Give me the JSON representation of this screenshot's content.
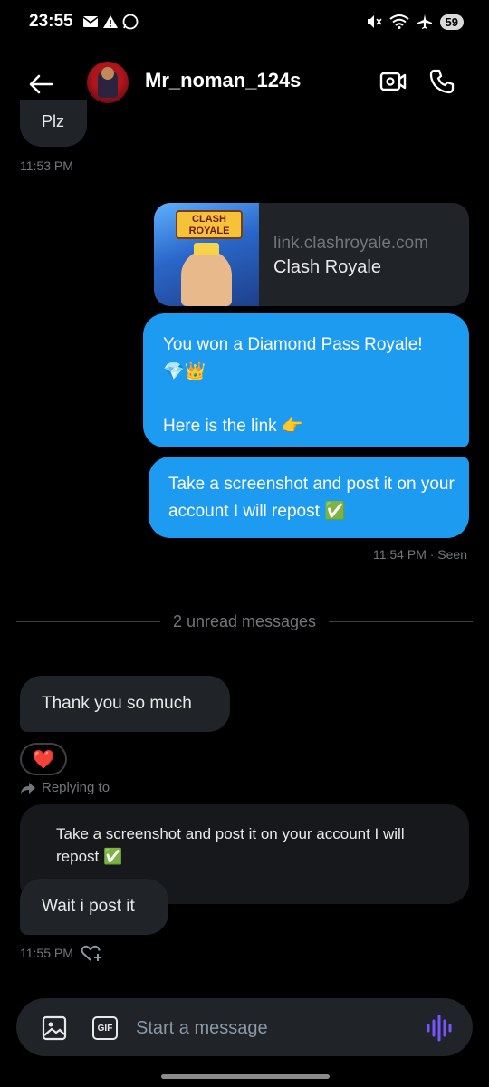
{
  "status_bar": {
    "time": "23:55",
    "battery": "59",
    "left_icons": [
      "mail-icon",
      "warning-icon",
      "whatsapp-icon"
    ],
    "right_icons": [
      "mute-icon",
      "wifi-icon",
      "airplane-icon"
    ]
  },
  "header": {
    "contact_name": "Mr_noman_124s"
  },
  "messages": {
    "plz": {
      "text": "Plz",
      "time": "11:53 PM"
    },
    "link_card": {
      "domain": "link.clashroyale.com",
      "title": "Clash Royale",
      "thumb_logo": "CLASH ROYALE"
    },
    "won": {
      "text": "You won a Diamond Pass Royale!\n💎👑\n\nHere is the link 👉"
    },
    "screenshot": {
      "text": "Take a screenshot and post it on your account I will repost ✅",
      "status": "11:54 PM · Seen"
    },
    "divider": "2 unread messages",
    "thanks": {
      "text": "Thank you so much",
      "reaction": "❤️"
    },
    "replying_label": "Replying to",
    "quoted": "Take a screenshot and post it on your account I will repost ✅",
    "wait": {
      "text": "Wait i post it",
      "time": "11:55 PM"
    }
  },
  "composer": {
    "placeholder": "Start a message",
    "gif_label": "GIF"
  },
  "colors": {
    "accent": "#1d9bf0",
    "incoming_bubble": "#202327",
    "muted_text": "#71767b",
    "voice_icon": "#7856ff"
  }
}
